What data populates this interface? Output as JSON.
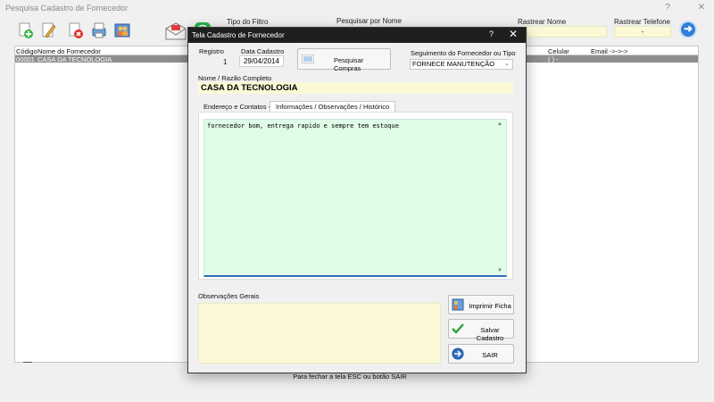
{
  "background": {
    "title": "Pesquisa Cadastro de Fornecedor",
    "title_buttons": [
      "?",
      "✕"
    ],
    "toolbar_icons": [
      "add-icon",
      "edit-icon",
      "delete-icon",
      "print-icon",
      "users-icon",
      "mail-icon",
      "whatsapp-icon"
    ],
    "filter": {
      "tipo_label": "Tipo do Filtro",
      "pesquisar_label": "Pesquisar por Nome",
      "rastrear_nome_label": "Rastrear Nome",
      "rastrear_telefone_label": "Rastrear Telefone",
      "rastrear_telefone_value": "-"
    },
    "grid": {
      "headers": [
        "Código",
        "Nome do Fornecedor",
        "Celular",
        "Email ->->->"
      ],
      "rows": [
        {
          "codigo": "00001",
          "nome": "CASA DA TECNOLOGIA",
          "celular": "( ) -"
        }
      ]
    },
    "footer_hint": "Para fechar a tela ESC ou botão SAIR"
  },
  "dialog": {
    "title": "Tela Cadastro de Fornecedor",
    "help": "?",
    "close": "✕",
    "registro_label": "Registro",
    "registro_value": "1",
    "data_label": "Data Cadastro",
    "data_value": "29/04/2014",
    "pesquisar_compras": "Pesquisar Compras",
    "segmento_label": "Seguimento do Fornecedor ou Tipo",
    "segmento_value": "FORNECE MANUTENÇÃO",
    "nome_label": "Nome / Razão Completo",
    "nome_value": "CASA DA TECNOLOGIA",
    "tabs": [
      "Endereço e Contatos ->",
      "Informações / Observações / Histórico"
    ],
    "observacoes_text": "fornecedor bom, entrega rapido e sempre tem estoque",
    "obs_gerais_label": "Observações Gerais",
    "buttons": {
      "imprimir": "Imprimir Ficha",
      "salvar": "Salvar Cadastro",
      "sair": "SAIR"
    }
  },
  "colors": {
    "dialog_titlebar": "#1f1f1f",
    "name_field_bg": "#fcfad6",
    "notes_bg": "#e0fbe6",
    "grid_selected_row": "#8e8e8e",
    "go_button": "#2f7fd6"
  }
}
